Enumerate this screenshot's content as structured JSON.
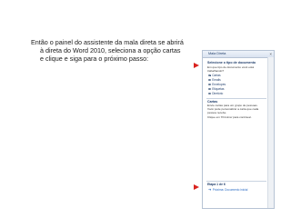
{
  "slide": {
    "lines": [
      "Então o painel do assistente da mala direta se abrirá",
      "à direta do Word 2010, seleciona a opção cartas",
      "e clique e siga para o próximo passo:"
    ]
  },
  "pane": {
    "title": "Mala Direta",
    "close_glyph": "×",
    "section_doc_type": {
      "title": "Selecione o tipo de documento",
      "question": "Em que tipo de documento você está trabalhando?",
      "options": [
        "Cartas",
        "Emails",
        "Envelopes",
        "Etiquetas",
        "Diretório"
      ],
      "selected_index": 0
    },
    "section_cartas": {
      "title": "Cartas",
      "description": "Envie cartas para um grupo de pessoas. Você pode personalizar a carta que cada pessoa recebe.",
      "instruction": "Clique em 'Próxima' para continuar."
    },
    "step": {
      "label": "Etapa 1 de 6",
      "next_label": "Próxima: Documento inicial"
    }
  },
  "colors": {
    "accent": "#1f3d6b",
    "link": "#2b6cc4",
    "pointer": "#d9231f"
  }
}
